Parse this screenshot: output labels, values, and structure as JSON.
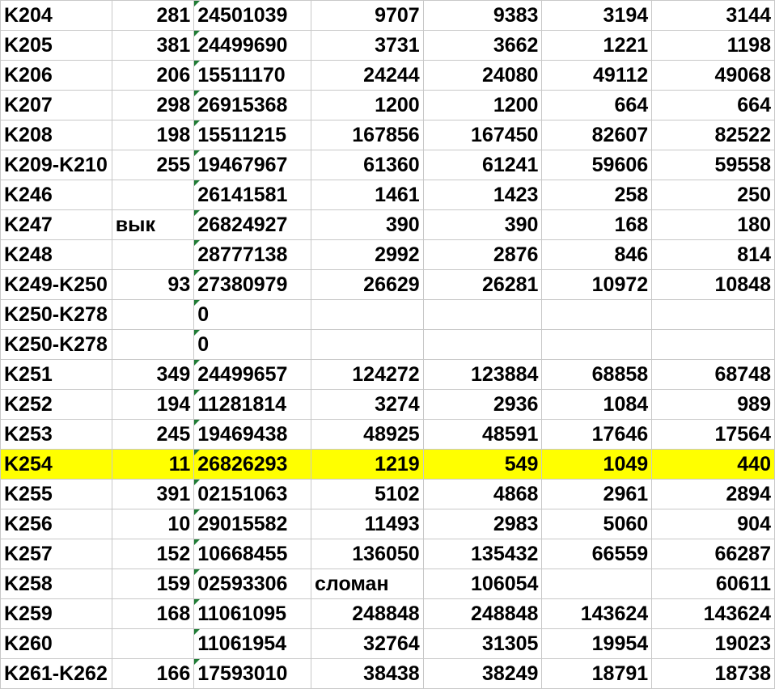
{
  "rows": [
    {
      "name": "K204",
      "num": "281",
      "meter": "24501039",
      "v1": "9707",
      "v2": "9383",
      "v3": "3194",
      "v4": "3144"
    },
    {
      "name": "K205",
      "num": "381",
      "meter": "24499690",
      "v1": "3731",
      "v2": "3662",
      "v3": "1221",
      "v4": "1198"
    },
    {
      "name": "K206",
      "num": "206",
      "meter": "15511170",
      "v1": "24244",
      "v2": "24080",
      "v3": "49112",
      "v4": "49068"
    },
    {
      "name": "K207",
      "num": "298",
      "meter": "26915368",
      "v1": "1200",
      "v2": "1200",
      "v3": "664",
      "v4": "664"
    },
    {
      "name": "K208",
      "num": "198",
      "meter": "15511215",
      "v1": "167856",
      "v2": "167450",
      "v3": "82607",
      "v4": "82522"
    },
    {
      "name": "K209-K210",
      "num": "255",
      "meter": "19467967",
      "v1": "61360",
      "v2": "61241",
      "v3": "59606",
      "v4": "59558"
    },
    {
      "name": "K246",
      "num": "",
      "meter": "26141581",
      "v1": "1461",
      "v2": "1423",
      "v3": "258",
      "v4": "250"
    },
    {
      "name": "K247",
      "num": "вык",
      "meter": "26824927",
      "v1": "390",
      "v2": "390",
      "v3": "168",
      "v4": "180"
    },
    {
      "name": "K248",
      "num": "",
      "meter": "28777138",
      "v1": "2992",
      "v2": "2876",
      "v3": "846",
      "v4": "814"
    },
    {
      "name": "K249-K250",
      "num": "93",
      "meter": "27380979",
      "v1": "26629",
      "v2": "26281",
      "v3": "10972",
      "v4": "10848"
    },
    {
      "name": "K250-K278",
      "num": "",
      "meter": "0",
      "v1": "",
      "v2": "",
      "v3": "",
      "v4": ""
    },
    {
      "name": "K250-K278",
      "num": "",
      "meter": "0",
      "v1": "",
      "v2": "",
      "v3": "",
      "v4": ""
    },
    {
      "name": "K251",
      "num": "349",
      "meter": "24499657",
      "v1": "124272",
      "v2": "123884",
      "v3": "68858",
      "v4": "68748"
    },
    {
      "name": "K252",
      "num": "194",
      "meter": "11281814",
      "v1": "3274",
      "v2": "2936",
      "v3": "1084",
      "v4": "989"
    },
    {
      "name": "K253",
      "num": "245",
      "meter": "19469438",
      "v1": "48925",
      "v2": "48591",
      "v3": "17646",
      "v4": "17564"
    },
    {
      "name": "K254",
      "num": "11",
      "meter": "26826293",
      "v1": "1219",
      "v2": "549",
      "v3": "1049",
      "v4": "440"
    },
    {
      "name": "K255",
      "num": "391",
      "meter": "02151063",
      "v1": "5102",
      "v2": "4868",
      "v3": "2961",
      "v4": "2894"
    },
    {
      "name": "K256",
      "num": "10",
      "meter": "29015582",
      "v1": "11493",
      "v2": "2983",
      "v3": "5060",
      "v4": "904"
    },
    {
      "name": "K257",
      "num": "152",
      "meter": "10668455",
      "v1": "136050",
      "v2": "135432",
      "v3": "66559",
      "v4": "66287"
    },
    {
      "name": "K258",
      "num": "159",
      "meter": "02593306",
      "v1": "сломан",
      "v2": "106054",
      "v3": "",
      "v4": "60611"
    },
    {
      "name": "K259",
      "num": "168",
      "meter": "11061095",
      "v1": "248848",
      "v2": "248848",
      "v3": "143624",
      "v4": "143624"
    },
    {
      "name": "K260",
      "num": "",
      "meter": "11061954",
      "v1": "32764",
      "v2": "31305",
      "v3": "19954",
      "v4": "19023"
    },
    {
      "name": "K261-K262",
      "num": "166",
      "meter": "17593010",
      "v1": "38438",
      "v2": "38249",
      "v3": "18791",
      "v4": "18738"
    }
  ],
  "highlight_row_name": "K254",
  "colors": {
    "highlight": "#ffff00",
    "gridline": "#c8c8c8",
    "text_marker": "#1e7b34"
  }
}
